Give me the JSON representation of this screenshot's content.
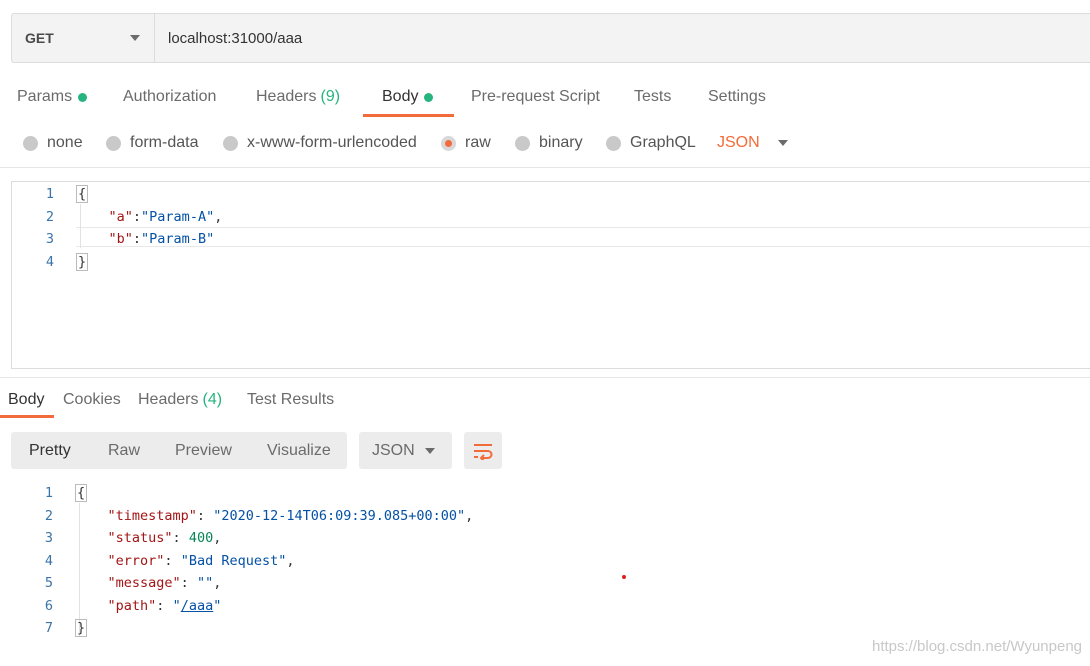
{
  "request": {
    "method": "GET",
    "url": "localhost:31000/aaa"
  },
  "request_tabs": [
    {
      "label": "Params",
      "dot": true
    },
    {
      "label": "Authorization"
    },
    {
      "label": "Headers",
      "count": "(9)"
    },
    {
      "label": "Body",
      "dot": true,
      "active": true
    },
    {
      "label": "Pre-request Script"
    },
    {
      "label": "Tests"
    },
    {
      "label": "Settings"
    }
  ],
  "body_types": {
    "options": [
      "none",
      "form-data",
      "x-www-form-urlencoded",
      "raw",
      "binary",
      "GraphQL"
    ],
    "selected": "raw",
    "language": "JSON"
  },
  "request_body": {
    "lines": [
      {
        "n": "1",
        "tokens": [
          {
            "t": "{",
            "c": "brace"
          }
        ]
      },
      {
        "n": "2",
        "tokens": [
          {
            "t": "    "
          },
          {
            "t": "\"a\"",
            "c": "k"
          },
          {
            "t": ":",
            "c": "p"
          },
          {
            "t": "\"Param-A\"",
            "c": "s"
          },
          {
            "t": ",",
            "c": "p"
          }
        ]
      },
      {
        "n": "3",
        "tokens": [
          {
            "t": "    "
          },
          {
            "t": "\"b\"",
            "c": "k"
          },
          {
            "t": ":",
            "c": "p"
          },
          {
            "t": "\"Param-B\"",
            "c": "s"
          }
        ]
      },
      {
        "n": "4",
        "tokens": [
          {
            "t": "}",
            "c": "brace"
          }
        ]
      }
    ]
  },
  "response_tabs": [
    {
      "label": "Body",
      "active": true
    },
    {
      "label": "Cookies"
    },
    {
      "label": "Headers",
      "count": "(4)"
    },
    {
      "label": "Test Results"
    }
  ],
  "response_toolbar": {
    "views": [
      "Pretty",
      "Raw",
      "Preview",
      "Visualize"
    ],
    "active_view": "Pretty",
    "format": "JSON",
    "wrap_icon": "wrap-lines-icon"
  },
  "response_body": {
    "lines": [
      {
        "n": "1",
        "tokens": [
          {
            "t": "{",
            "c": "brace"
          }
        ]
      },
      {
        "n": "2",
        "tokens": [
          {
            "t": "    "
          },
          {
            "t": "\"timestamp\"",
            "c": "k"
          },
          {
            "t": ": ",
            "c": "p"
          },
          {
            "t": "\"2020-12-14T06:09:39.085+00:00\"",
            "c": "s"
          },
          {
            "t": ",",
            "c": "p"
          }
        ]
      },
      {
        "n": "3",
        "tokens": [
          {
            "t": "    "
          },
          {
            "t": "\"status\"",
            "c": "k"
          },
          {
            "t": ": ",
            "c": "p"
          },
          {
            "t": "400",
            "c": "n"
          },
          {
            "t": ",",
            "c": "p"
          }
        ]
      },
      {
        "n": "4",
        "tokens": [
          {
            "t": "    "
          },
          {
            "t": "\"error\"",
            "c": "k"
          },
          {
            "t": ": ",
            "c": "p"
          },
          {
            "t": "\"Bad Request\"",
            "c": "s"
          },
          {
            "t": ",",
            "c": "p"
          }
        ]
      },
      {
        "n": "5",
        "tokens": [
          {
            "t": "    "
          },
          {
            "t": "\"message\"",
            "c": "k"
          },
          {
            "t": ": ",
            "c": "p"
          },
          {
            "t": "\"\"",
            "c": "s"
          },
          {
            "t": ",",
            "c": "p"
          }
        ]
      },
      {
        "n": "6",
        "tokens": [
          {
            "t": "    "
          },
          {
            "t": "\"path\"",
            "c": "k"
          },
          {
            "t": ": ",
            "c": "p"
          },
          {
            "t": "\"",
            "c": "s"
          },
          {
            "t": "/aaa",
            "c": "s link-underline"
          },
          {
            "t": "\"",
            "c": "s"
          }
        ]
      },
      {
        "n": "7",
        "tokens": [
          {
            "t": "}",
            "c": "brace"
          }
        ]
      }
    ]
  },
  "watermark": "https://blog.csdn.net/Wyunpeng",
  "colors": {
    "accent": "#f26b3a",
    "status_green": "#26b47f",
    "json_key": "#a31515",
    "json_string": "#0451a5",
    "json_number": "#098658"
  }
}
